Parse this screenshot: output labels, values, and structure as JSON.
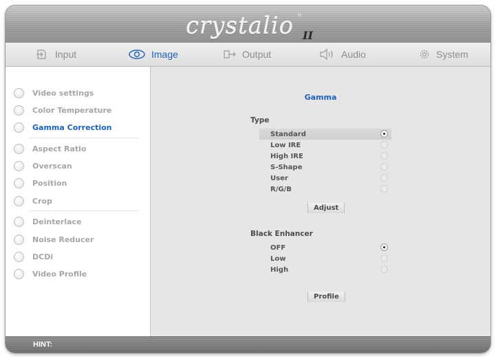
{
  "brand": {
    "logo_text": "crystalio",
    "logo_mark": "II",
    "reg_mark": "®"
  },
  "nav": [
    {
      "label": "Input",
      "icon": "input-icon",
      "active": false
    },
    {
      "label": "Image",
      "icon": "eye-icon",
      "active": true
    },
    {
      "label": "Output",
      "icon": "output-icon",
      "active": false
    },
    {
      "label": "Audio",
      "icon": "speaker-icon",
      "active": false
    },
    {
      "label": "System",
      "icon": "gear-icon",
      "active": false
    }
  ],
  "sidebar": {
    "items": [
      {
        "label": "Video settings"
      },
      {
        "label": "Color Temperature"
      },
      {
        "label": "Gamma Correction",
        "active": true
      },
      {
        "label": "Aspect Ratio"
      },
      {
        "label": "Overscan"
      },
      {
        "label": "Position"
      },
      {
        "label": "Crop"
      },
      {
        "label": "Deinterlace"
      },
      {
        "label": "Noise Reducer"
      },
      {
        "label": "DCDi"
      },
      {
        "label": "Video Profile"
      }
    ]
  },
  "main": {
    "heading": "Gamma",
    "type_section": {
      "label": "Type",
      "options": [
        "Standard",
        "Low IRE",
        "High IRE",
        "S-Shape",
        "User",
        "R/G/B"
      ],
      "selected": "Standard",
      "button": "Adjust"
    },
    "black_section": {
      "label": "Black Enhancer",
      "options": [
        "OFF",
        "Low",
        "High"
      ],
      "selected": "OFF"
    },
    "profile_button": "Profile"
  },
  "footer": {
    "hint_label": "HINT:"
  },
  "colors": {
    "accent": "#1b62b7",
    "inactive_text": "#a6a6a6",
    "panel_bg": "#e6e6e6"
  }
}
